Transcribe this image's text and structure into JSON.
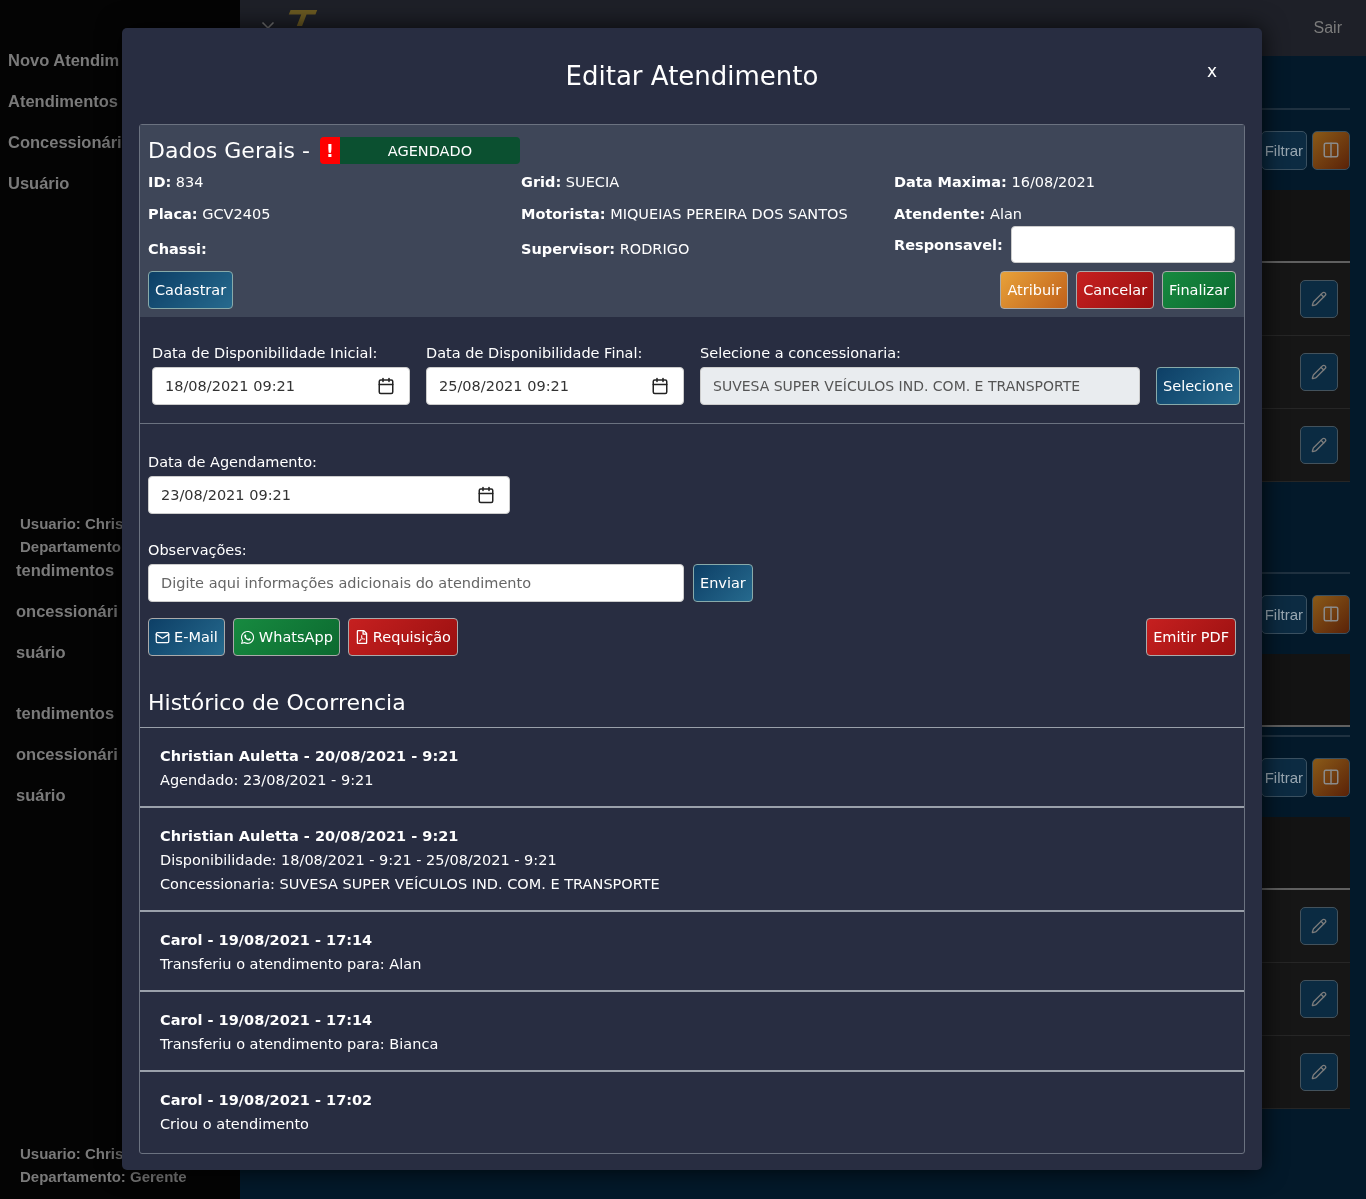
{
  "topbar": {
    "logout": "Sair"
  },
  "sidebar": {
    "groups": [
      {
        "kind": "menu",
        "items": [
          "Novo Atendim",
          "Atendimentos",
          "Concessionári",
          "Usuário"
        ]
      },
      {
        "kind": "user",
        "items": [
          "Usuario: Chris",
          "Departamento"
        ]
      },
      {
        "kind": "menu-cut",
        "items": [
          "tendimentos",
          "oncessionári",
          "suário"
        ]
      },
      {
        "kind": "menu-cut",
        "items": [
          "tendimentos",
          "oncessionári",
          "suário"
        ]
      },
      {
        "kind": "user",
        "items": [
          "Usuario: Chris",
          "Departamento: Gerente"
        ]
      }
    ]
  },
  "panels": [
    {
      "filter_button": "Filtrar"
    },
    {
      "filter_button": "Filtrar"
    },
    {
      "filter_button": "Filtrar"
    }
  ],
  "modal": {
    "title": "Editar Atendimento",
    "close": "x",
    "general": {
      "heading": "Dados Gerais -",
      "alert": "!",
      "status": "AGENDADO",
      "fields": [
        {
          "kind": "text",
          "label": "ID:",
          "value": "834"
        },
        {
          "kind": "text",
          "label": "Grid:",
          "value": "SUECIA"
        },
        {
          "kind": "text",
          "label": "Data Maxima:",
          "value": "16/08/2021"
        },
        {
          "kind": "text",
          "label": "Placa:",
          "value": "GCV2405"
        },
        {
          "kind": "text",
          "label": "Motorista:",
          "value": "MIQUEIAS PEREIRA DOS SANTOS"
        },
        {
          "kind": "text",
          "label": "Atendente:",
          "value": "Alan"
        },
        {
          "kind": "text",
          "label": "Chassi:"
        },
        {
          "kind": "text",
          "label": "Supervisor:",
          "value": "RODRIGO"
        },
        {
          "kind": "input",
          "label": "Responsavel:"
        }
      ],
      "register_button": "Cadastrar",
      "actions": [
        {
          "label": "Atribuir",
          "kind": "warning"
        },
        {
          "label": "Cancelar",
          "kind": "danger"
        },
        {
          "label": "Finalizar",
          "kind": "success"
        }
      ]
    },
    "availability": {
      "start_label": "Data de Disponibilidade Inicial:",
      "start_value": "18/08/2021 09:21",
      "end_label": "Data de Disponibilidade Final:",
      "end_value": "25/08/2021 09:21",
      "dealer_label": "Selecione a concessionaria:",
      "dealer_value": "SUVESA SUPER VEÍCULOS IND. COM. E TRANSPORTE",
      "select_button": "Selecione"
    },
    "schedule": {
      "label": "Data de Agendamento:",
      "value": "23/08/2021 09:21"
    },
    "notes": {
      "label": "Observações:",
      "placeholder": "Digite aqui informações adicionais do atendimento",
      "send_button": "Enviar"
    },
    "share_buttons": [
      {
        "label": "E-Mail",
        "kind": "email"
      },
      {
        "label": "WhatsApp",
        "kind": "whatsapp"
      },
      {
        "label": "Requisição",
        "kind": "pdf"
      }
    ],
    "pdf_button": "Emitir PDF",
    "history": {
      "title": "Histórico de Ocorrencia",
      "entries": [
        {
          "header": "Christian Auletta - 20/08/2021 - 9:21",
          "lines": [
            "Agendado: 23/08/2021 - 9:21"
          ]
        },
        {
          "header": "Christian Auletta - 20/08/2021 - 9:21",
          "lines": [
            "Disponibilidade: 18/08/2021 - 9:21 - 25/08/2021 - 9:21",
            "Concessionaria: SUVESA SUPER VEÍCULOS IND. COM. E TRANSPORTE"
          ]
        },
        {
          "header": "Carol - 19/08/2021 - 17:14",
          "lines": [
            "Transferiu o atendimento para: Alan"
          ]
        },
        {
          "header": "Carol - 19/08/2021 - 17:14",
          "lines": [
            "Transferiu o atendimento para: Bianca"
          ]
        },
        {
          "header": "Carol - 19/08/2021 - 17:02",
          "lines": [
            "Criou o atendimento"
          ]
        }
      ]
    }
  }
}
